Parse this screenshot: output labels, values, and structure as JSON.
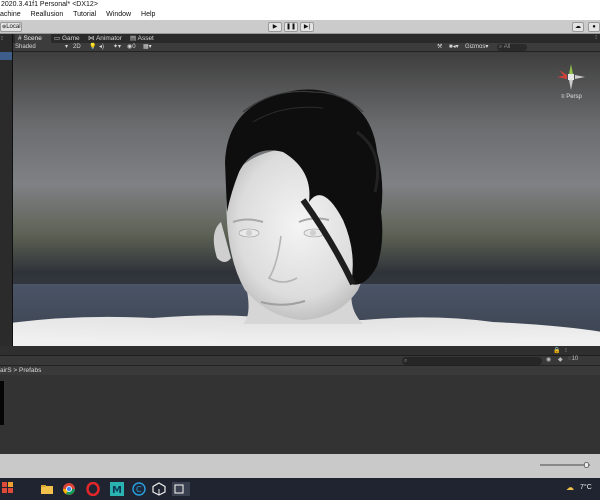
{
  "title_bar": {
    "text": "2020.3.41f1 Personal* <DX12>"
  },
  "menu": {
    "items": [
      "achine",
      "Reallusion",
      "Tutorial",
      "Window",
      "Help"
    ]
  },
  "toolbar": {
    "local_label": "Local",
    "play_icon": "play-icon",
    "pause_icon": "pause-icon",
    "step_icon": "step-icon"
  },
  "scene": {
    "tabs": [
      {
        "label": "Scene",
        "icon": "grid-icon",
        "active": true
      },
      {
        "label": "Game",
        "icon": "gamepad-icon",
        "active": false
      },
      {
        "label": "Animator",
        "icon": "animator-icon",
        "active": false
      },
      {
        "label": "Asset Store",
        "icon": "store-icon",
        "active": false
      }
    ],
    "shading_mode": "Shaded",
    "dimension_label": "2D",
    "gizmos_label": "Gizmos",
    "search_placeholder": "All",
    "persp_label": "Persp"
  },
  "project": {
    "breadcrumb": [
      "airS",
      "Prefabs"
    ],
    "separator": ">",
    "visible_count": "10"
  },
  "taskbar": {
    "temperature": "7°C",
    "icons": [
      "file-explorer-icon",
      "chrome-icon",
      "opera-icon",
      "app-m-icon",
      "app-c-icon",
      "unity-icon",
      "unity-hub-icon"
    ]
  },
  "colors": {
    "viewport_sky": "#7f8185",
    "panel_dark": "#383838",
    "taskbar": "#1f2430"
  }
}
